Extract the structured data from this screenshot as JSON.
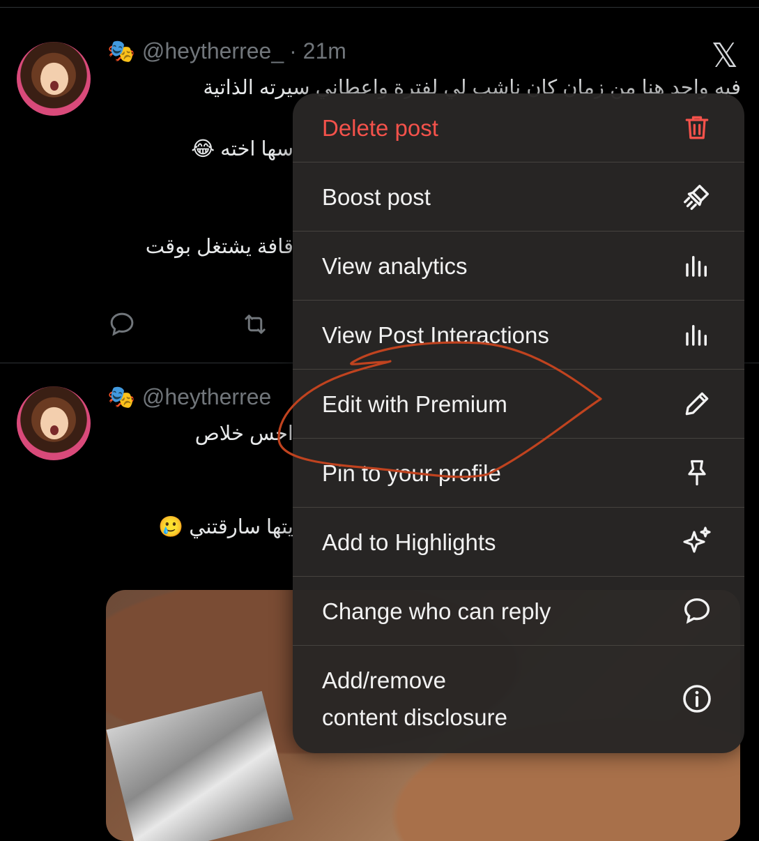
{
  "posts": [
    {
      "handle": "@heytherree_",
      "time": "· 21m",
      "mask_emoji": "🎭",
      "lines": [
        "فيه واحد هنا من زمان كان ناشب لي لفترة واعطاني سيرته الذاتية",
        "سها اخته 😂",
        "قافة يشتغل بوقت"
      ]
    },
    {
      "handle": "@heytherree",
      "mask_emoji": "🎭",
      "lines": [
        "احس خلاص",
        "يتها سارقتني 🥲"
      ]
    }
  ],
  "menu": {
    "items": [
      {
        "label": "Delete post",
        "icon": "trash-icon",
        "color": "#f4524b"
      },
      {
        "label": "Boost post",
        "icon": "rocket-icon"
      },
      {
        "label": "View analytics",
        "icon": "bar-chart-icon"
      },
      {
        "label": "View Post Interactions",
        "icon": "bar-chart-icon"
      },
      {
        "label": "Edit with Premium",
        "icon": "pencil-icon"
      },
      {
        "label": "Pin to your profile",
        "icon": "pin-icon"
      },
      {
        "label": "Add to Highlights",
        "icon": "sparkle-icon"
      },
      {
        "label": "Change who can reply",
        "icon": "speech-bubble-icon"
      },
      {
        "label": "Add/remove\ncontent disclosure",
        "icon": "info-icon"
      }
    ]
  },
  "colors": {
    "background": "#000000",
    "menu_bg": "#282625",
    "danger": "#f4524b",
    "annotation": "#c0431f"
  }
}
